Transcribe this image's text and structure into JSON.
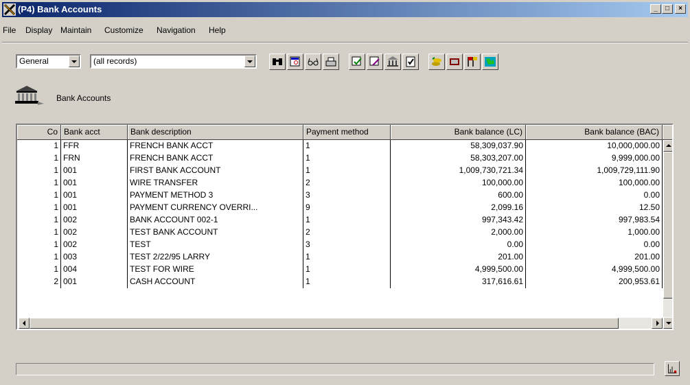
{
  "window": {
    "title": "(P4) Bank Accounts",
    "minimize_label": "_",
    "maximize_label": "□",
    "close_label": "×"
  },
  "menu": [
    "File",
    "Display",
    "Maintain",
    "Customize",
    "Navigation",
    "Help"
  ],
  "toolbar": {
    "view_select": "General",
    "records_select": "(all records)",
    "icons": [
      "binoculars-icon",
      "find-form-icon",
      "glasses-icon",
      "print-icon",
      "forms-icon",
      "edit-forms-icon",
      "bank-building-icon",
      "checklist-icon",
      "coins-icon",
      "book-icon",
      "flags-icon",
      "map-icon"
    ]
  },
  "caption": "Bank Accounts",
  "table": {
    "columns": [
      "Co",
      "Bank acct",
      "Bank description",
      "Payment method",
      "Bank balance (LC)",
      "Bank balance (BAC)"
    ],
    "rows": [
      [
        "1",
        "FFR",
        "FRENCH BANK ACCT",
        "1",
        "58,309,037.90",
        "10,000,000.00"
      ],
      [
        "1",
        "FRN",
        "FRENCH BANK ACCT",
        "1",
        "58,303,207.00",
        "9,999,000.00"
      ],
      [
        "1",
        "001",
        "FIRST BANK ACCOUNT",
        "1",
        "1,009,730,721.34",
        "1,009,729,111.90"
      ],
      [
        "1",
        "001",
        "WIRE TRANSFER",
        "2",
        "100,000.00",
        "100,000.00"
      ],
      [
        "1",
        "001",
        "PAYMENT METHOD 3",
        "3",
        "600.00",
        "0.00"
      ],
      [
        "1",
        "001",
        "PAYMENT CURRENCY OVERRI...",
        "9",
        "2,099.16",
        "12.50"
      ],
      [
        "1",
        "002",
        "BANK ACCOUNT 002-1",
        "1",
        "997,343.42",
        "997,983.54"
      ],
      [
        "1",
        "002",
        "TEST BANK ACCOUNT",
        "2",
        "2,000.00",
        "1,000.00"
      ],
      [
        "1",
        "002",
        "TEST",
        "3",
        "0.00",
        "0.00"
      ],
      [
        "1",
        "003",
        "TEST 2/22/95 LARRY",
        "1",
        "201.00",
        "201.00"
      ],
      [
        "1",
        "004",
        "TEST FOR WIRE",
        "1",
        "4,999,500.00",
        "4,999,500.00"
      ],
      [
        "2",
        "001",
        "CASH ACCOUNT",
        "1",
        "317,616.61",
        "200,953.61"
      ]
    ]
  },
  "status_text": ""
}
